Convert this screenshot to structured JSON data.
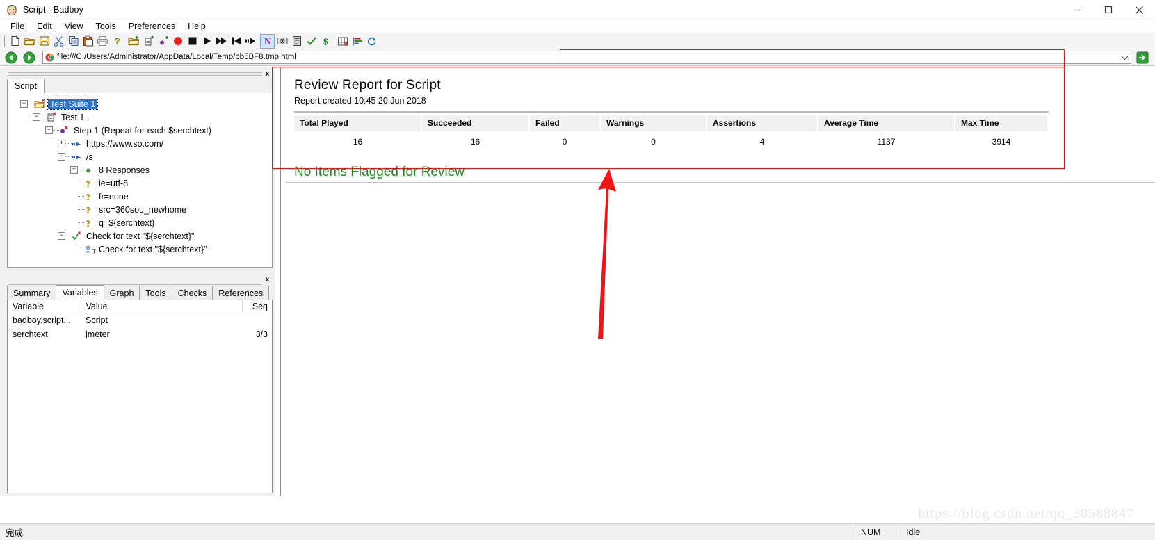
{
  "window": {
    "title": "Script - Badboy",
    "app_icon": "badboy-face-icon",
    "minimize_label": "—",
    "maximize_label": "□",
    "close_label": "✕"
  },
  "menubar": {
    "items": [
      {
        "label": "File"
      },
      {
        "label": "Edit"
      },
      {
        "label": "View"
      },
      {
        "label": "Tools"
      },
      {
        "label": "Preferences"
      },
      {
        "label": "Help"
      }
    ]
  },
  "toolbar": {
    "buttons": [
      {
        "name": "new-icon"
      },
      {
        "name": "open-folder-icon"
      },
      {
        "name": "save-icon"
      },
      {
        "name": "cut-scissors-icon"
      },
      {
        "name": "copy-icon"
      },
      {
        "name": "paste-icon"
      },
      {
        "name": "print-icon"
      },
      {
        "name": "help-question-icon"
      },
      {
        "name": "new-suite-folder-icon"
      },
      {
        "name": "new-test-icon"
      },
      {
        "name": "new-step-icon"
      },
      {
        "name": "record-icon"
      },
      {
        "name": "stop-icon"
      },
      {
        "name": "play-icon"
      },
      {
        "name": "play-fast-icon"
      },
      {
        "name": "play-from-start-icon"
      },
      {
        "name": "step-icon"
      },
      {
        "name": "jmeter-icon"
      },
      {
        "name": "screenshot-icon"
      },
      {
        "name": "report-icon"
      },
      {
        "name": "check-icon"
      },
      {
        "name": "variable-dollar-icon"
      },
      {
        "name": "table-grid-icon"
      },
      {
        "name": "chart-bars-icon"
      },
      {
        "name": "refresh-icon"
      }
    ]
  },
  "address_bar": {
    "back_label": "back-arrow-icon",
    "forward_label": "forward-arrow-icon",
    "favicon": "chrome-icon",
    "url": "file:///C:/Users/Administrator/AppData/Local/Temp/bb5BF8.tmp.html",
    "dropdown_label": "∨",
    "go_label": "go-arrow-icon"
  },
  "left_panel": {
    "close_label": "x",
    "tab": {
      "label": "Script"
    },
    "tree": [
      {
        "depth": 0,
        "expander": "-",
        "icon": "folder-open-error-icon",
        "label": "Test Suite 1",
        "selected": true
      },
      {
        "depth": 1,
        "expander": "-",
        "icon": "test-page-error-icon",
        "label": "Test 1",
        "selected": false
      },
      {
        "depth": 2,
        "expander": "-",
        "icon": "step-dot-error-icon",
        "label": "Step 1 (Repeat for each $serchtext)",
        "selected": false
      },
      {
        "depth": 3,
        "expander": "+",
        "icon": "navigate-arrow-icon",
        "label": "https://www.so.com/",
        "selected": false
      },
      {
        "depth": 3,
        "expander": "-",
        "icon": "navigate-arrow-icon",
        "label": "/s",
        "selected": false
      },
      {
        "depth": 4,
        "expander": "+",
        "icon": "green-dot-icon",
        "label": "8 Responses",
        "selected": false
      },
      {
        "depth": 4,
        "expander": "",
        "icon": "param-key-icon",
        "label": "ie=utf-8",
        "selected": false
      },
      {
        "depth": 4,
        "expander": "",
        "icon": "param-key-icon",
        "label": "fr=none",
        "selected": false
      },
      {
        "depth": 4,
        "expander": "",
        "icon": "param-key-icon",
        "label": "src=360sou_newhome",
        "selected": false
      },
      {
        "depth": 4,
        "expander": "",
        "icon": "param-key-icon",
        "label": "q=${serchtext}",
        "selected": false
      },
      {
        "depth": 3,
        "expander": "-",
        "icon": "check-green-error-icon",
        "label": "Check for text \"${serchtext}\"",
        "selected": false
      },
      {
        "depth": 4,
        "expander": "",
        "icon": "check-text-icon",
        "label": "Check for text \"${serchtext}\"",
        "selected": false
      }
    ]
  },
  "bottom_panel": {
    "close_label": "x",
    "tabs": [
      {
        "label": "Summary",
        "selected": false
      },
      {
        "label": "Variables",
        "selected": true
      },
      {
        "label": "Graph",
        "selected": false
      },
      {
        "label": "Tools",
        "selected": false
      },
      {
        "label": "Checks",
        "selected": false
      },
      {
        "label": "References",
        "selected": false
      }
    ],
    "variables_table": {
      "columns": [
        "Variable",
        "Value",
        "Seq"
      ],
      "rows": [
        {
          "variable": "badboy.script...",
          "value": "Script",
          "seq": ""
        },
        {
          "variable": "serchtext",
          "value": "jmeter",
          "seq": "3/3"
        }
      ]
    }
  },
  "report": {
    "title": "Review Report for Script",
    "subtitle": "Report created 10:45 20 Jun 2018",
    "columns": [
      "Total Played",
      "Succeeded",
      "Failed",
      "Warnings",
      "Assertions",
      "Average Time",
      "Max Time"
    ],
    "values": [
      "16",
      "16",
      "0",
      "0",
      "4",
      "1137",
      "3914"
    ],
    "no_items_message": "No Items Flagged for Review"
  },
  "statusbar": {
    "message": "完成",
    "num_indicator": "NUM",
    "state": "Idle"
  },
  "watermark": "https://blog.csdn.net/qq_38588847",
  "colors": {
    "accent_blue": "#2a6fc9",
    "green_text": "#1f8a1f",
    "annotation_red": "#ee1111",
    "toolbar_bg": "#f4f4f4"
  }
}
